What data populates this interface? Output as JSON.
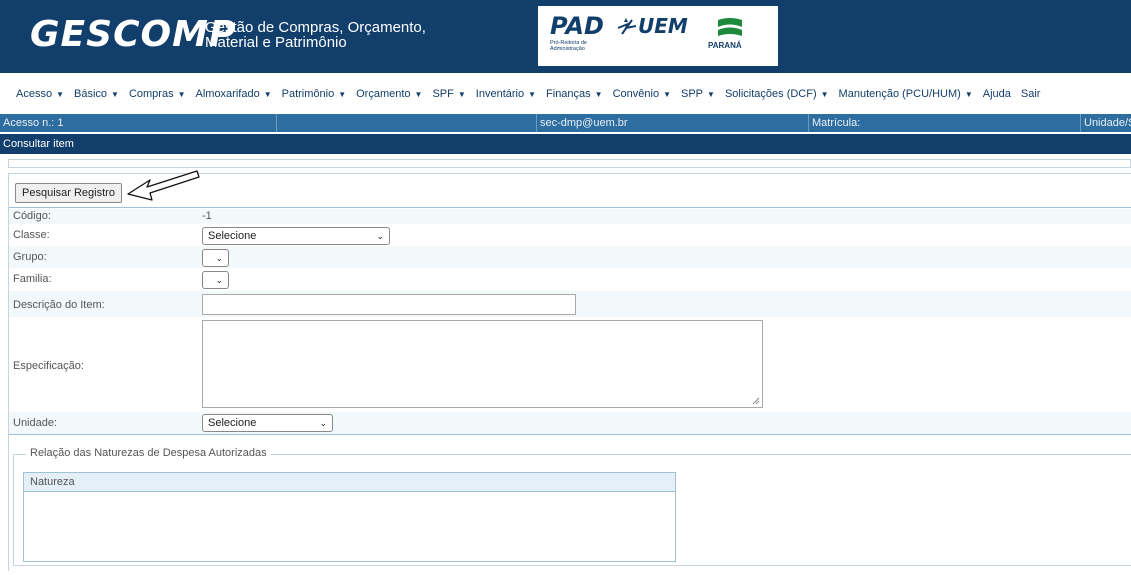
{
  "header": {
    "logo": "GESCOMP",
    "subtitle_line1": "Gestão de Compras, Orçamento,",
    "subtitle_line2": "Material e Patrimônio",
    "pad": "PAD",
    "pad_sub_line1": "Pró-Reitoria de",
    "pad_sub_line2": "Administração",
    "uem": "UEM",
    "parana": "PARANÁ"
  },
  "menu": [
    {
      "label": "Acesso",
      "caret": true
    },
    {
      "label": "Básico",
      "caret": true
    },
    {
      "label": "Compras",
      "caret": true
    },
    {
      "label": "Almoxarifado",
      "caret": true
    },
    {
      "label": "Patrimônio",
      "caret": true
    },
    {
      "label": "Orçamento",
      "caret": true
    },
    {
      "label": "SPF",
      "caret": true
    },
    {
      "label": "Inventário",
      "caret": true
    },
    {
      "label": "Finanças",
      "caret": true
    },
    {
      "label": "Convênio",
      "caret": true
    },
    {
      "label": "SPP",
      "caret": true
    },
    {
      "label": "Solicitações (DCF)",
      "caret": true
    },
    {
      "label": "Manutenção (PCU/HUM)",
      "caret": true
    },
    {
      "label": "Ajuda",
      "caret": false
    },
    {
      "label": "Sair",
      "caret": false
    }
  ],
  "infobar": {
    "acesso": "Acesso n.: 1",
    "email": "sec-dmp@uem.br",
    "matricula": "Matrícula:",
    "unidade": "Unidade/S"
  },
  "page_title": "Consultar item",
  "search_button": "Pesquisar Registro",
  "form": {
    "codigo_label": "Código:",
    "codigo_value": "-1",
    "classe_label": "Classe:",
    "classe_value": "Selecione",
    "grupo_label": "Grupo:",
    "familia_label": "Familia:",
    "descricao_label": "Descrição do Item:",
    "especificacao_label": "Especificação:",
    "unidade_label": "Unidade:",
    "unidade_value": "Selecione"
  },
  "naturezas": {
    "legend": "Relação das Naturezas de Despesa Autorizadas",
    "column": "Natureza"
  },
  "icons": {
    "caret": "▼",
    "chevron": "⌄"
  },
  "colors": {
    "header_bg": "#123e6b",
    "infobar_bg": "#2e6da0",
    "menu_text": "#123e6b"
  }
}
